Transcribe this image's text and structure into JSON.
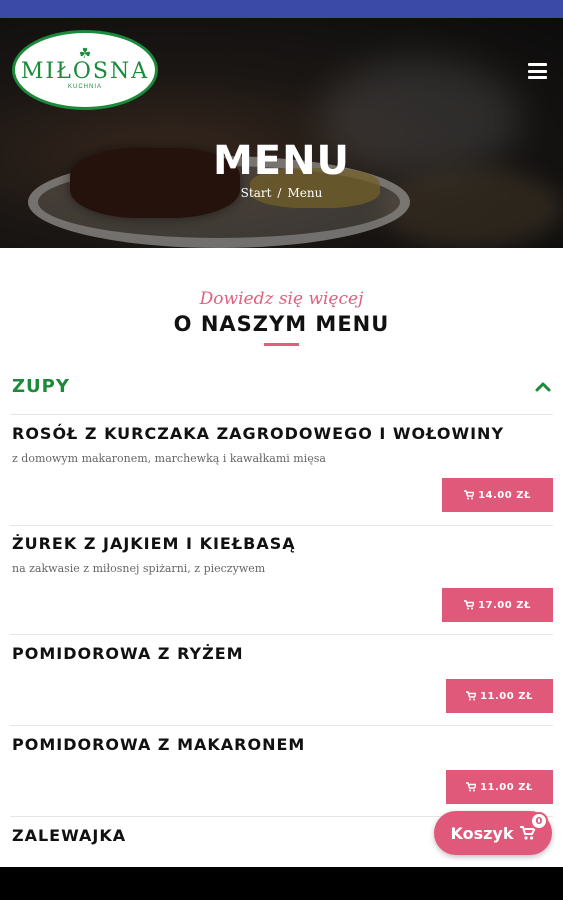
{
  "colors": {
    "accent": "#e0587a",
    "brand_green": "#1b8a3b",
    "status_bar": "#3a4aa6"
  },
  "header": {
    "logo_text": "MIŁOSNA",
    "logo_subtext": "KUCHNIA",
    "menu_icon": "hamburger-icon",
    "title": "MENU",
    "breadcrumb": {
      "home": "Start",
      "separator": "/",
      "current": "Menu"
    }
  },
  "intro": {
    "script_text": "Dowiedz się więcej",
    "title": "O NASZYM MENU"
  },
  "category": {
    "title": "ZUPY",
    "toggle_icon": "chevron-up-icon",
    "items": [
      {
        "name": "ROSÓŁ Z KURCZAKA ZAGRODOWEGO I WOŁOWINY",
        "description": "z domowym makaronem, marchewką i kawałkami mięsa",
        "price": "14.00 ZŁ"
      },
      {
        "name": "ŻUREK Z JAJKIEM I KIEŁBASĄ",
        "description": "na zakwasie z miłosnej spiżarni, z pieczywem",
        "price": "17.00 ZŁ"
      },
      {
        "name": "POMIDOROWA Z RYŻEM",
        "description": "",
        "price": "11.00 ZŁ"
      },
      {
        "name": "POMIDOROWA Z MAKARONEM",
        "description": "",
        "price": "11.00 ZŁ"
      },
      {
        "name": "ZALEWAJKA",
        "description": "",
        "price": ""
      }
    ]
  },
  "cart": {
    "label": "Koszyk",
    "count": "0",
    "icon": "cart-icon"
  }
}
